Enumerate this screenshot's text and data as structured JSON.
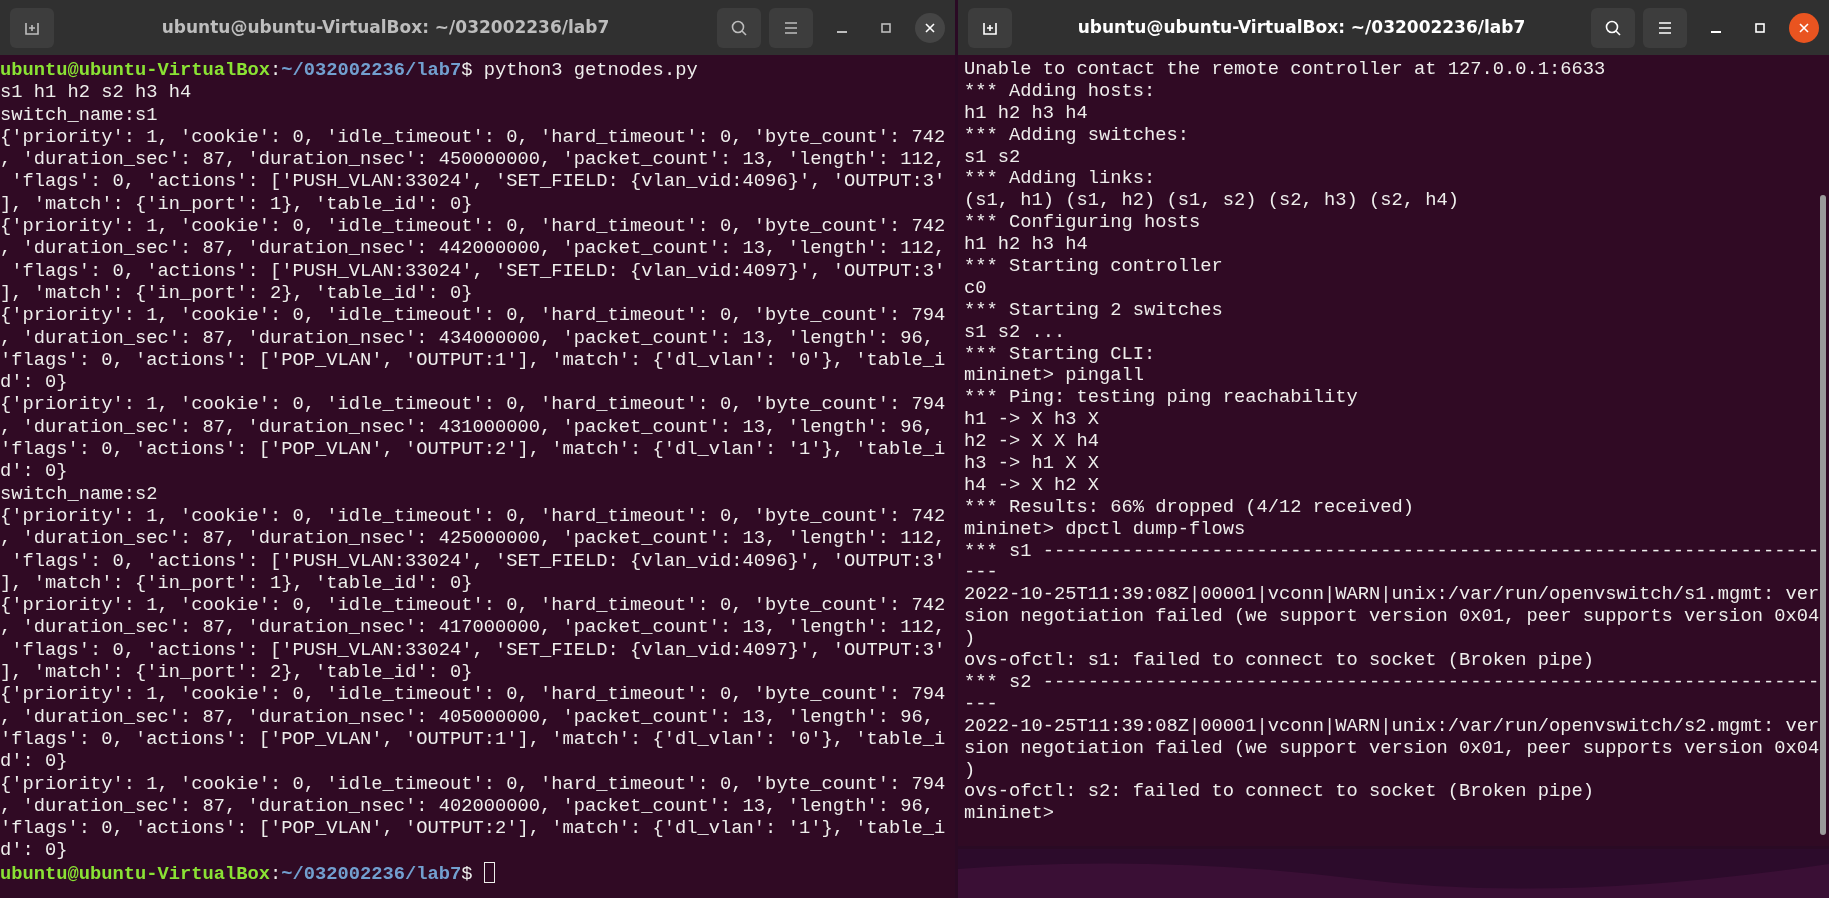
{
  "windows": [
    {
      "title": "ubuntu@ubuntu-VirtualBox: ~/032002236/lab7",
      "focused": false,
      "lines": [
        {
          "kind": "prompt",
          "user": "ubuntu@ubuntu-VirtualBox",
          "separator": ":",
          "path": "~/032002236/lab7",
          "command": "$ python3 getnodes.py"
        },
        {
          "kind": "output",
          "text": "s1 h1 h2 s2 h3 h4"
        },
        {
          "kind": "output",
          "text": "switch_name:s1"
        },
        {
          "kind": "output",
          "text": "{'priority': 1, 'cookie': 0, 'idle_timeout': 0, 'hard_timeout': 0, 'byte_count': 742"
        },
        {
          "kind": "output",
          "text": ", 'duration_sec': 87, 'duration_nsec': 450000000, 'packet_count': 13, 'length': 112,"
        },
        {
          "kind": "output",
          "text": " 'flags': 0, 'actions': ['PUSH_VLAN:33024', 'SET_FIELD: {vlan_vid:4096}', 'OUTPUT:3'"
        },
        {
          "kind": "output",
          "text": "], 'match': {'in_port': 1}, 'table_id': 0}"
        },
        {
          "kind": "output",
          "text": "{'priority': 1, 'cookie': 0, 'idle_timeout': 0, 'hard_timeout': 0, 'byte_count': 742"
        },
        {
          "kind": "output",
          "text": ", 'duration_sec': 87, 'duration_nsec': 442000000, 'packet_count': 13, 'length': 112,"
        },
        {
          "kind": "output",
          "text": " 'flags': 0, 'actions': ['PUSH_VLAN:33024', 'SET_FIELD: {vlan_vid:4097}', 'OUTPUT:3'"
        },
        {
          "kind": "output",
          "text": "], 'match': {'in_port': 2}, 'table_id': 0}"
        },
        {
          "kind": "output",
          "text": "{'priority': 1, 'cookie': 0, 'idle_timeout': 0, 'hard_timeout': 0, 'byte_count': 794"
        },
        {
          "kind": "output",
          "text": ", 'duration_sec': 87, 'duration_nsec': 434000000, 'packet_count': 13, 'length': 96,"
        },
        {
          "kind": "output",
          "text": "'flags': 0, 'actions': ['POP_VLAN', 'OUTPUT:1'], 'match': {'dl_vlan': '0'}, 'table_i"
        },
        {
          "kind": "output",
          "text": "d': 0}"
        },
        {
          "kind": "output",
          "text": "{'priority': 1, 'cookie': 0, 'idle_timeout': 0, 'hard_timeout': 0, 'byte_count': 794"
        },
        {
          "kind": "output",
          "text": ", 'duration_sec': 87, 'duration_nsec': 431000000, 'packet_count': 13, 'length': 96,"
        },
        {
          "kind": "output",
          "text": "'flags': 0, 'actions': ['POP_VLAN', 'OUTPUT:2'], 'match': {'dl_vlan': '1'}, 'table_i"
        },
        {
          "kind": "output",
          "text": "d': 0}"
        },
        {
          "kind": "output",
          "text": "switch_name:s2"
        },
        {
          "kind": "output",
          "text": "{'priority': 1, 'cookie': 0, 'idle_timeout': 0, 'hard_timeout': 0, 'byte_count': 742"
        },
        {
          "kind": "output",
          "text": ", 'duration_sec': 87, 'duration_nsec': 425000000, 'packet_count': 13, 'length': 112,"
        },
        {
          "kind": "output",
          "text": " 'flags': 0, 'actions': ['PUSH_VLAN:33024', 'SET_FIELD: {vlan_vid:4096}', 'OUTPUT:3'"
        },
        {
          "kind": "output",
          "text": "], 'match': {'in_port': 1}, 'table_id': 0}"
        },
        {
          "kind": "output",
          "text": "{'priority': 1, 'cookie': 0, 'idle_timeout': 0, 'hard_timeout': 0, 'byte_count': 742"
        },
        {
          "kind": "output",
          "text": ", 'duration_sec': 87, 'duration_nsec': 417000000, 'packet_count': 13, 'length': 112,"
        },
        {
          "kind": "output",
          "text": " 'flags': 0, 'actions': ['PUSH_VLAN:33024', 'SET_FIELD: {vlan_vid:4097}', 'OUTPUT:3'"
        },
        {
          "kind": "output",
          "text": "], 'match': {'in_port': 2}, 'table_id': 0}"
        },
        {
          "kind": "output",
          "text": "{'priority': 1, 'cookie': 0, 'idle_timeout': 0, 'hard_timeout': 0, 'byte_count': 794"
        },
        {
          "kind": "output",
          "text": ", 'duration_sec': 87, 'duration_nsec': 405000000, 'packet_count': 13, 'length': 96,"
        },
        {
          "kind": "output",
          "text": "'flags': 0, 'actions': ['POP_VLAN', 'OUTPUT:1'], 'match': {'dl_vlan': '0'}, 'table_i"
        },
        {
          "kind": "output",
          "text": "d': 0}"
        },
        {
          "kind": "output",
          "text": "{'priority': 1, 'cookie': 0, 'idle_timeout': 0, 'hard_timeout': 0, 'byte_count': 794"
        },
        {
          "kind": "output",
          "text": ", 'duration_sec': 87, 'duration_nsec': 402000000, 'packet_count': 13, 'length': 96,"
        },
        {
          "kind": "output",
          "text": "'flags': 0, 'actions': ['POP_VLAN', 'OUTPUT:2'], 'match': {'dl_vlan': '1'}, 'table_i"
        },
        {
          "kind": "output",
          "text": "d': 0}"
        },
        {
          "kind": "prompt",
          "user": "ubuntu@ubuntu-VirtualBox",
          "separator": ":",
          "path": "~/032002236/lab7",
          "command": "$ ",
          "cursor": true
        }
      ]
    },
    {
      "title": "ubuntu@ubuntu-VirtualBox: ~/032002236/lab7",
      "focused": true,
      "lines": [
        {
          "kind": "output",
          "text": "Unable to contact the remote controller at 127.0.0.1:6633"
        },
        {
          "kind": "output",
          "text": "*** Adding hosts:"
        },
        {
          "kind": "output",
          "text": "h1 h2 h3 h4"
        },
        {
          "kind": "output",
          "text": "*** Adding switches:"
        },
        {
          "kind": "output",
          "text": "s1 s2"
        },
        {
          "kind": "output",
          "text": "*** Adding links:"
        },
        {
          "kind": "output",
          "text": "(s1, h1) (s1, h2) (s1, s2) (s2, h3) (s2, h4)"
        },
        {
          "kind": "output",
          "text": "*** Configuring hosts"
        },
        {
          "kind": "output",
          "text": "h1 h2 h3 h4"
        },
        {
          "kind": "output",
          "text": "*** Starting controller"
        },
        {
          "kind": "output",
          "text": "c0"
        },
        {
          "kind": "output",
          "text": "*** Starting 2 switches"
        },
        {
          "kind": "output",
          "text": "s1 s2 ..."
        },
        {
          "kind": "output",
          "text": "*** Starting CLI:"
        },
        {
          "kind": "output",
          "text": "mininet> pingall"
        },
        {
          "kind": "output",
          "text": "*** Ping: testing ping reachability"
        },
        {
          "kind": "output",
          "text": "h1 -> X h3 X"
        },
        {
          "kind": "output",
          "text": "h2 -> X X h4"
        },
        {
          "kind": "output",
          "text": "h3 -> h1 X X"
        },
        {
          "kind": "output",
          "text": "h4 -> X h2 X"
        },
        {
          "kind": "output",
          "text": "*** Results: 66% dropped (4/12 received)"
        },
        {
          "kind": "output",
          "text": "mininet> dpctl dump-flows"
        },
        {
          "kind": "output",
          "text": "*** s1 ---------------------------------------------------------------------"
        },
        {
          "kind": "output",
          "text": "---"
        },
        {
          "kind": "output",
          "text": "2022-10-25T11:39:08Z|00001|vconn|WARN|unix:/var/run/openvswitch/s1.mgmt: ver"
        },
        {
          "kind": "output",
          "text": "sion negotiation failed (we support version 0x01, peer supports version 0x04"
        },
        {
          "kind": "output",
          "text": ")"
        },
        {
          "kind": "output",
          "text": "ovs-ofctl: s1: failed to connect to socket (Broken pipe)"
        },
        {
          "kind": "output",
          "text": "*** s2 ---------------------------------------------------------------------"
        },
        {
          "kind": "output",
          "text": "---"
        },
        {
          "kind": "output",
          "text": "2022-10-25T11:39:08Z|00001|vconn|WARN|unix:/var/run/openvswitch/s2.mgmt: ver"
        },
        {
          "kind": "output",
          "text": "sion negotiation failed (we support version 0x01, peer supports version 0x04"
        },
        {
          "kind": "output",
          "text": ")"
        },
        {
          "kind": "output",
          "text": "ovs-ofctl: s2: failed to connect to socket (Broken pipe)"
        },
        {
          "kind": "output",
          "text": "mininet>"
        }
      ]
    }
  ]
}
